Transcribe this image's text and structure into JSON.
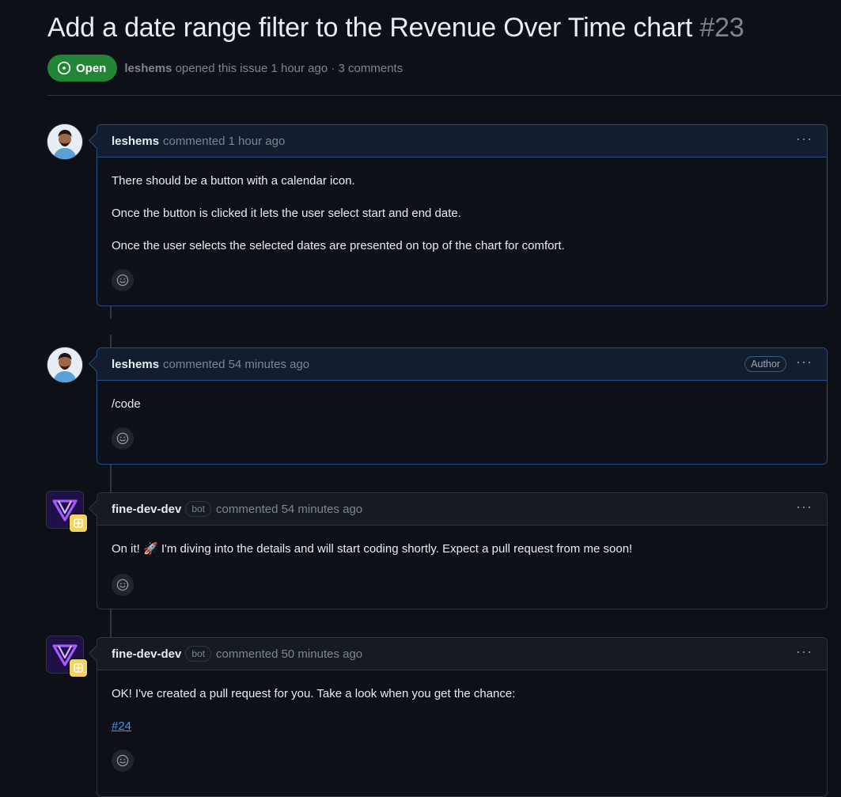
{
  "issue": {
    "title": "Add a date range filter to the Revenue Over Time chart",
    "number": "#23",
    "state": "Open",
    "opened_by": "leshems",
    "opened_text": "opened this issue 1 hour ago · 3 comments"
  },
  "comments": [
    {
      "author": "leshems",
      "action": "commented 1 hour ago",
      "paragraphs": [
        "There should be a button with a calendar icon.",
        "Once the button is clicked it lets the user select start and end date.",
        "Once the user selects the selected dates are presented on top of the chart for comfort."
      ]
    },
    {
      "author": "leshems",
      "action": "commented 54 minutes ago",
      "label": "Author",
      "paragraphs": [
        "/code"
      ]
    },
    {
      "author": "fine-dev-dev",
      "bot_label": "bot",
      "action": "commented 54 minutes ago",
      "paragraphs": [
        "On it! 🚀 I'm diving into the details and will start coding shortly. Expect a pull request from me soon!"
      ]
    },
    {
      "author": "fine-dev-dev",
      "bot_label": "bot",
      "action": "commented 50 minutes ago",
      "paragraphs": [
        "OK! I've created a pull request for you. Take a look when you get the chance:"
      ],
      "link": "#24"
    }
  ],
  "menu_glyph": "···",
  "colors": {
    "open": "#238636",
    "link": "#4493f8",
    "background": "#0d1117"
  }
}
